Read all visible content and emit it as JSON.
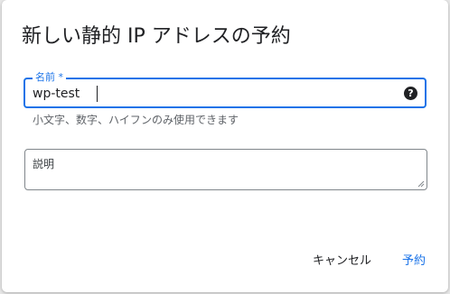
{
  "dialog": {
    "title": "新しい静的 IP アドレスの予約"
  },
  "name_field": {
    "label": "名前 *",
    "value": "wp-test",
    "help_icon": "question-circle-icon",
    "help_glyph": "?",
    "hint": "小文字、数字、ハイフンのみ使用できます"
  },
  "description_field": {
    "placeholder": "説明",
    "value": ""
  },
  "actions": {
    "cancel_label": "キャンセル",
    "reserve_label": "予約"
  },
  "colors": {
    "accent": "#1a73e8",
    "text": "#202124",
    "secondary_text": "#5f6368",
    "border": "#80868b"
  }
}
